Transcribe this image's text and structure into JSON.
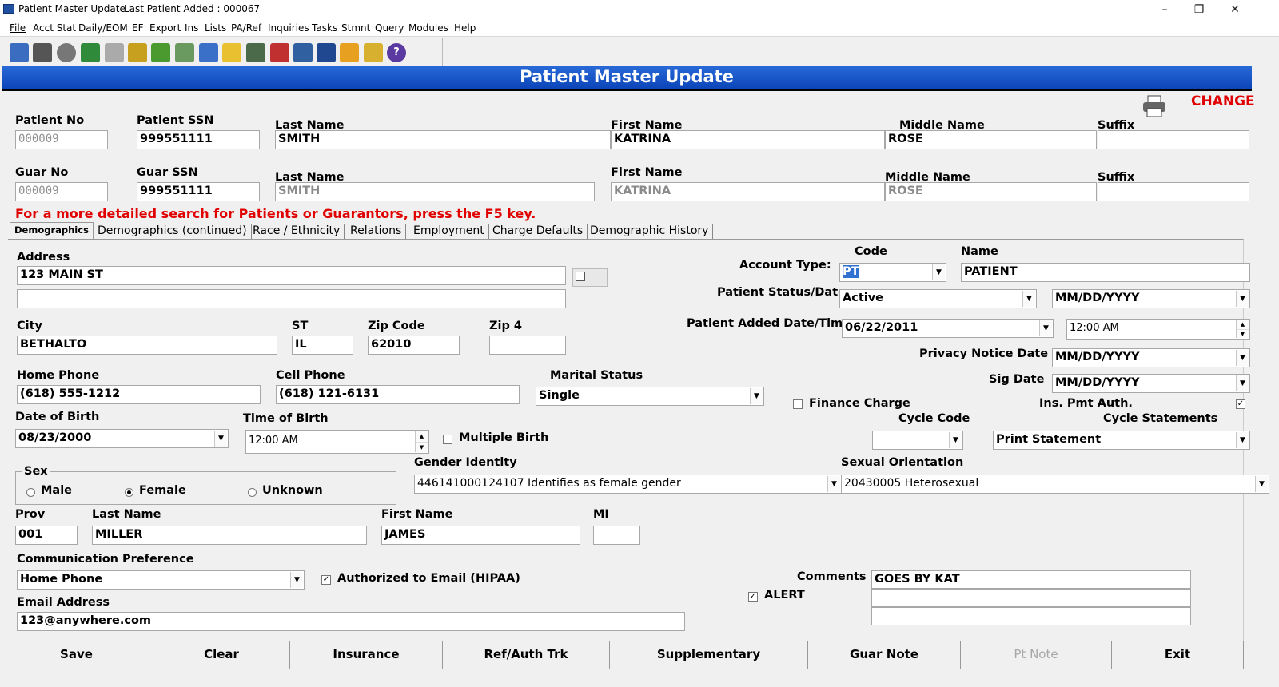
{
  "window": {
    "title": "Patient Master Update",
    "last_added": "Last Patient Added : 000067",
    "minimize": "–",
    "restore": "❐",
    "close": "✕"
  },
  "menu": [
    "File",
    "Acct Stat",
    "Daily/EOM",
    "EF",
    "Export",
    "Ins",
    "Lists",
    "PA/Ref",
    "Inquiries",
    "Tasks",
    "Stmnt",
    "Query",
    "Modules",
    "Help"
  ],
  "toolbar_icons": [
    "home-icon",
    "printer-icon",
    "gear-icon",
    "user-add-icon",
    "phone-icon",
    "calculator-icon",
    "arrows-icon",
    "note-add-icon",
    "book-icon",
    "mail-icon",
    "scanner-icon",
    "ledger-icon",
    "card-icon",
    "device-icon",
    "pin-icon",
    "pin-plus-icon",
    "help-icon"
  ],
  "banner": "Patient Master Update",
  "mode": "CHANGE",
  "patient": {
    "no_label": "Patient No",
    "no": "000009",
    "ssn_label": "Patient SSN",
    "ssn": "999551111",
    "last_label": "Last Name",
    "last": "SMITH",
    "first_label": "First Name",
    "first": "KATRINA",
    "middle_label": "Middle Name",
    "middle": "ROSE",
    "suffix_label": "Suffix",
    "suffix": ""
  },
  "guarantor": {
    "no_label": "Guar No",
    "no": "000009",
    "ssn_label": "Guar SSN",
    "ssn": "999551111",
    "last_label": "Last Name",
    "last": "SMITH",
    "first_label": "First Name",
    "first": "KATRINA",
    "middle_label": "Middle Name",
    "middle": "ROSE",
    "suffix_label": "Suffix",
    "suffix": ""
  },
  "search_hint": "For a more detailed search for Patients or Guarantors, press the F5 key.",
  "tabs": [
    "Demographics",
    "Demographics (continued)",
    "Race / Ethnicity",
    "Relations",
    "Employment",
    "Charge Defaults",
    "Demographic History"
  ],
  "demo": {
    "address_label": "Address",
    "address1": "123 MAIN ST",
    "address2": "",
    "city_label": "City",
    "city": "BETHALTO",
    "st_label": "ST",
    "st": "IL",
    "zip_label": "Zip Code",
    "zip": "62010",
    "zip4_label": "Zip 4",
    "zip4": "",
    "home_phone_label": "Home Phone",
    "home_phone": "(618) 555-1212",
    "cell_phone_label": "Cell Phone",
    "cell_phone": "(618) 121-6131",
    "marital_label": "Marital Status",
    "marital": "Single",
    "dob_label": "Date of Birth",
    "dob": "08/23/2000",
    "tob_label": "Time of Birth",
    "tob": "12:00 AM",
    "multiple_birth_label": "Multiple Birth",
    "sex_label": "Sex",
    "sex_male": "Male",
    "sex_female": "Female",
    "sex_unknown": "Unknown",
    "gender_identity_label": "Gender Identity",
    "gender_identity": "446141000124107 Identifies as female gender",
    "sexual_orientation_label": "Sexual Orientation",
    "sexual_orientation": "20430005 Heterosexual",
    "prov_label": "Prov",
    "prov": "001",
    "prov_last_label": "Last Name",
    "prov_last": "MILLER",
    "prov_first_label": "First Name",
    "prov_first": "JAMES",
    "prov_mi_label": "MI",
    "prov_mi": "",
    "comm_pref_label": "Communication Preference",
    "comm_pref": "Home Phone",
    "auth_email_label": "Authorized to Email (HIPAA)",
    "email_label": "Email Address",
    "email": "123@anywhere.com",
    "code_label": "Code",
    "name_label": "Name",
    "account_type_label": "Account Type:",
    "account_type_code": "PT",
    "account_type_name": "PATIENT",
    "status_label": "Patient Status/Date",
    "status": "Active",
    "status_date": "MM/DD/YYYY",
    "added_label": "Patient Added Date/Time",
    "added_date": "06/22/2011",
    "added_time": "12:00 AM",
    "privacy_label": "Privacy Notice Date",
    "privacy_date": "MM/DD/YYYY",
    "sig_label": "Sig Date",
    "sig_date": "MM/DD/YYYY",
    "finance_label": "Finance Charge",
    "ins_pmt_label": "Ins. Pmt Auth.",
    "cycle_code_label": "Cycle Code",
    "cycle_code": "",
    "cycle_stmt_label": "Cycle Statements",
    "cycle_stmt": "Print Statement",
    "comments_label": "Comments",
    "comment1": "GOES BY KAT",
    "comment2": "",
    "comment3": "",
    "alert_label": "ALERT"
  },
  "buttons": [
    "Save",
    "Clear",
    "Insurance",
    "Ref/Auth Trk",
    "Supplementary",
    "Guar Note",
    "Pt Note",
    "Exit"
  ]
}
